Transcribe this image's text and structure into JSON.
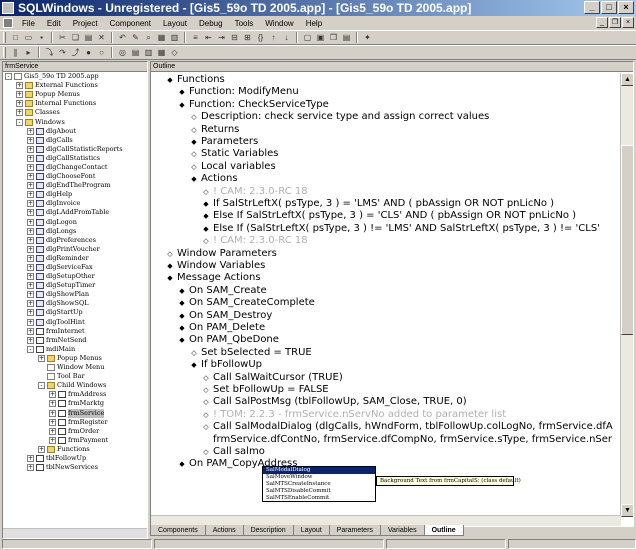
{
  "window": {
    "title": "SQLWindows - Unregistered - [Gis5_59o TD 2005.app] - [Gis5_59o TD 2005.app]"
  },
  "menu": [
    "File",
    "Edit",
    "Project",
    "Component",
    "Layout",
    "Debug",
    "Tools",
    "Window",
    "Help"
  ],
  "left_pane": {
    "header": "frmService",
    "tree": [
      {
        "label": "Gis5_59o TD 2005.app",
        "depth": 0,
        "exp": "-",
        "icon": "doc"
      },
      {
        "label": "External Functions",
        "depth": 1,
        "exp": "+",
        "icon": "folder"
      },
      {
        "label": "Popup Menus",
        "depth": 1,
        "exp": "+",
        "icon": "folder"
      },
      {
        "label": "Internal Functions",
        "depth": 1,
        "exp": "+",
        "icon": "folder"
      },
      {
        "label": "Classes",
        "depth": 1,
        "exp": "+",
        "icon": "folder"
      },
      {
        "label": "Windows",
        "depth": 1,
        "exp": "-",
        "icon": "folder"
      },
      {
        "label": "dlgAbout",
        "depth": 2,
        "exp": "+",
        "icon": "dlg"
      },
      {
        "label": "dlgCalls",
        "depth": 2,
        "exp": "+",
        "icon": "dlg"
      },
      {
        "label": "dlgCallStatisticReports",
        "depth": 2,
        "exp": "+",
        "icon": "dlg"
      },
      {
        "label": "dlgCallStatistics",
        "depth": 2,
        "exp": "+",
        "icon": "dlg"
      },
      {
        "label": "dlgChangeContact",
        "depth": 2,
        "exp": "+",
        "icon": "dlg"
      },
      {
        "label": "dlgChooseFont",
        "depth": 2,
        "exp": "+",
        "icon": "dlg"
      },
      {
        "label": "dlgEndTheProgram",
        "depth": 2,
        "exp": "+",
        "icon": "dlg"
      },
      {
        "label": "dlgHelp",
        "depth": 2,
        "exp": "+",
        "icon": "dlg"
      },
      {
        "label": "dlgInvoice",
        "depth": 2,
        "exp": "+",
        "icon": "dlg"
      },
      {
        "label": "dlgLAddFromTable",
        "depth": 2,
        "exp": "+",
        "icon": "dlg"
      },
      {
        "label": "dlgLogon",
        "depth": 2,
        "exp": "+",
        "icon": "dlg"
      },
      {
        "label": "dlgLongs",
        "depth": 2,
        "exp": "+",
        "icon": "dlg"
      },
      {
        "label": "dlgPreferences",
        "depth": 2,
        "exp": "+",
        "icon": "dlg"
      },
      {
        "label": "dlgPrintVoucher",
        "depth": 2,
        "exp": "+",
        "icon": "dlg"
      },
      {
        "label": "dlgReminder",
        "depth": 2,
        "exp": "+",
        "icon": "dlg"
      },
      {
        "label": "dlgServiceFax",
        "depth": 2,
        "exp": "+",
        "icon": "dlg"
      },
      {
        "label": "dlgSetupOther",
        "depth": 2,
        "exp": "+",
        "icon": "dlg"
      },
      {
        "label": "dlgSetupTimer",
        "depth": 2,
        "exp": "+",
        "icon": "dlg"
      },
      {
        "label": "dlgShowPlan",
        "depth": 2,
        "exp": "+",
        "icon": "dlg"
      },
      {
        "label": "dlgShowSQL",
        "depth": 2,
        "exp": "+",
        "icon": "dlg"
      },
      {
        "label": "dlgStartUp",
        "depth": 2,
        "exp": "+",
        "icon": "dlg"
      },
      {
        "label": "dlgToolHint",
        "depth": 2,
        "exp": "+",
        "icon": "dlg"
      },
      {
        "label": "frmInternet",
        "depth": 2,
        "exp": "+",
        "icon": "frm"
      },
      {
        "label": "frmNetSend",
        "depth": 2,
        "exp": "+",
        "icon": "frm"
      },
      {
        "label": "mdiMain",
        "depth": 2,
        "exp": "-",
        "icon": "frm"
      },
      {
        "label": "Popup Menus",
        "depth": 3,
        "exp": "+",
        "icon": "folder"
      },
      {
        "label": "Window Menu",
        "depth": 3,
        "exp": "",
        "icon": "doc"
      },
      {
        "label": "Tool Bar",
        "depth": 3,
        "exp": "",
        "icon": "doc"
      },
      {
        "label": "Child Windows",
        "depth": 3,
        "exp": "-",
        "icon": "folder"
      },
      {
        "label": "frmAddress",
        "depth": 4,
        "exp": "+",
        "icon": "frm"
      },
      {
        "label": "frmMarktg",
        "depth": 4,
        "exp": "+",
        "icon": "frm"
      },
      {
        "label": "frmService",
        "depth": 4,
        "exp": "+",
        "icon": "frm",
        "selected": true
      },
      {
        "label": "frmRegister",
        "depth": 4,
        "exp": "+",
        "icon": "frm"
      },
      {
        "label": "frmOrder",
        "depth": 4,
        "exp": "+",
        "icon": "frm"
      },
      {
        "label": "frmPayment",
        "depth": 4,
        "exp": "+",
        "icon": "frm"
      },
      {
        "label": "Functions",
        "depth": 3,
        "exp": "+",
        "icon": "folder"
      },
      {
        "label": "tblFollowUp",
        "depth": 2,
        "exp": "+",
        "icon": "frm"
      },
      {
        "label": "tblNewServices",
        "depth": 2,
        "exp": "+",
        "icon": "frm"
      }
    ]
  },
  "right_pane": {
    "header": "Outline",
    "lines": [
      {
        "text": "Functions",
        "depth": 1,
        "bullet": "diamond"
      },
      {
        "text": "Function: ModifyMenu",
        "depth": 2,
        "bullet": "diamond"
      },
      {
        "text": "Function: CheckServiceType",
        "depth": 2,
        "bullet": "diamond"
      },
      {
        "text": "Description: check service type and assign correct values",
        "depth": 3,
        "bullet": "hollow"
      },
      {
        "text": "Returns",
        "depth": 3,
        "bullet": "hollow"
      },
      {
        "text": "Parameters",
        "depth": 3,
        "bullet": "diamond"
      },
      {
        "text": "Static Variables",
        "depth": 3,
        "bullet": "hollow"
      },
      {
        "text": "Local variables",
        "depth": 3,
        "bullet": "hollow"
      },
      {
        "text": "Actions",
        "depth": 3,
        "bullet": "diamond"
      },
      {
        "text": "! CAM: 2.3.0-RC 18",
        "depth": 4,
        "bullet": "hollow",
        "comment": true
      },
      {
        "text": "If SalStrLeftX( psType, 3 ) = 'LMS' AND ( pbAssign OR NOT pnLicNo )",
        "depth": 4,
        "bullet": "diamond"
      },
      {
        "text": "Else If SalStrLeftX( psType, 3 ) = 'CLS' AND ( pbAssign OR NOT pnLicNo )",
        "depth": 4,
        "bullet": "diamond"
      },
      {
        "text": "Else If (SalStrLeftX( psType, 3 ) != 'LMS' AND SalStrLeftX( psType, 3 ) != 'CLS'",
        "depth": 4,
        "bullet": "diamond"
      },
      {
        "text": "! CAM: 2.3.0-RC 18",
        "depth": 4,
        "bullet": "hollow",
        "comment": true
      },
      {
        "text": "Window Parameters",
        "depth": 1,
        "bullet": "hollow"
      },
      {
        "text": "Window Variables",
        "depth": 1,
        "bullet": "diamond"
      },
      {
        "text": "Message Actions",
        "depth": 1,
        "bullet": "diamond"
      },
      {
        "text": "On SAM_Create",
        "depth": 2,
        "bullet": "diamond"
      },
      {
        "text": "On SAM_CreateComplete",
        "depth": 2,
        "bullet": "diamond"
      },
      {
        "text": "On SAM_Destroy",
        "depth": 2,
        "bullet": "diamond"
      },
      {
        "text": "On PAM_Delete",
        "depth": 2,
        "bullet": "diamond"
      },
      {
        "text": "On PAM_QbeDone",
        "depth": 2,
        "bullet": "diamond"
      },
      {
        "text": "Set bSelected = TRUE",
        "depth": 3,
        "bullet": "hollow"
      },
      {
        "text": "If bFollowUp",
        "depth": 3,
        "bullet": "diamond"
      },
      {
        "text": "Call SalWaitCursor (TRUE)",
        "depth": 4,
        "bullet": "hollow"
      },
      {
        "text": "Set bFollowUp = FALSE",
        "depth": 4,
        "bullet": "hollow"
      },
      {
        "text": "Call SalPostMsg (tblFollowUp, SAM_Close, TRUE, 0)",
        "depth": 4,
        "bullet": "hollow"
      },
      {
        "text": "! TOM: 2.2.3 - frmService.nServNo added to parameter list",
        "depth": 4,
        "bullet": "hollow",
        "comment": true
      },
      {
        "text": "Call SalModalDialog (dlgCalls, hWndForm, tblFollowUp.colLogNo, frmService.dfA",
        "depth": 4,
        "bullet": "hollow"
      },
      {
        "text": "frmService.dfContNo, frmService.dfCompNo, frmService.sType, frmService.nSer",
        "depth": 4,
        "bullet": "none"
      },
      {
        "text": "Call salmo",
        "depth": 4,
        "bullet": "hollow"
      },
      {
        "text": "On PAM_CopyAddress",
        "depth": 2,
        "bullet": "diamond"
      }
    ]
  },
  "autocomplete": {
    "items": [
      "SalModalDialog",
      "SalMoveWindow",
      "SalMTSCreateInstance",
      "SalMTSDisableCommit",
      "SalMTSEnableCommit"
    ],
    "tooltip": "Background Text from frmCapitalS: (class default)"
  },
  "tabs": [
    "Components",
    "Actions",
    "Description",
    "Layout",
    "Parameters",
    "Variables",
    "Outline"
  ],
  "active_tab": "Outline"
}
